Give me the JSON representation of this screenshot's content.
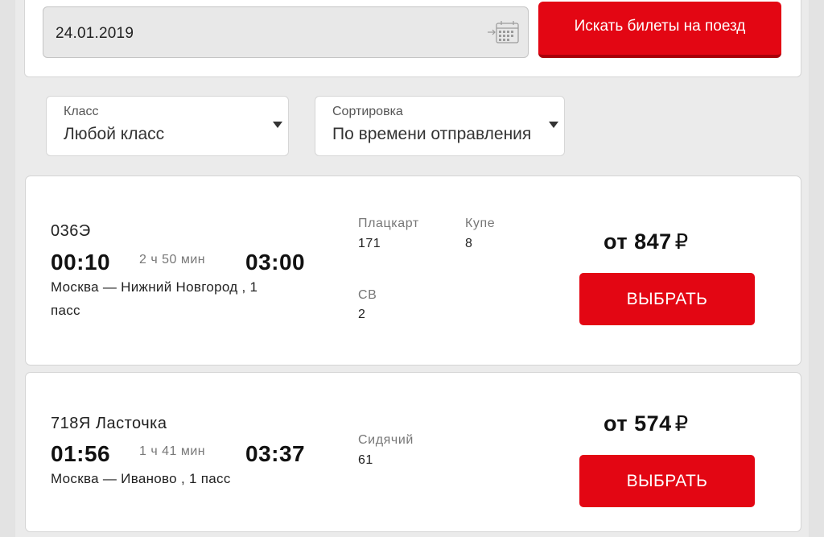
{
  "search": {
    "date_value": "24.01.2019",
    "calendar_icon": "calendar-icon",
    "search_button_label": "Искать билеты на поезд"
  },
  "filters": {
    "class_label": "Класс",
    "class_value": "Любой класс",
    "sort_label": "Сортировка",
    "sort_value": "По времени отправления"
  },
  "trains": [
    {
      "number": "036Э",
      "departure": "00:10",
      "duration": "2 ч 50 мин",
      "arrival": "03:00",
      "route_line1": "Москва  — Нижний Новгород , 1",
      "route_line2": "пасс",
      "seats": [
        {
          "type": "Плацкарт",
          "count": "171"
        },
        {
          "type": "Купе",
          "count": "8"
        },
        {
          "type": "СВ",
          "count": "2"
        }
      ],
      "price_prefix": "от",
      "price": "847",
      "currency": "₽",
      "button_label": "ВЫБРАТЬ"
    },
    {
      "number": "718Я Ласточка",
      "departure": "01:56",
      "duration": "1 ч 41 мин",
      "arrival": "03:37",
      "route_line1": "Москва  — Иваново , 1 пасс",
      "seats": [
        {
          "type": "Сидячий",
          "count": "61"
        }
      ],
      "price_prefix": "от",
      "price": "574",
      "currency": "₽",
      "button_label": "ВЫБРАТЬ"
    }
  ],
  "colors": {
    "accent": "#e30613",
    "background": "#ebebeb"
  }
}
